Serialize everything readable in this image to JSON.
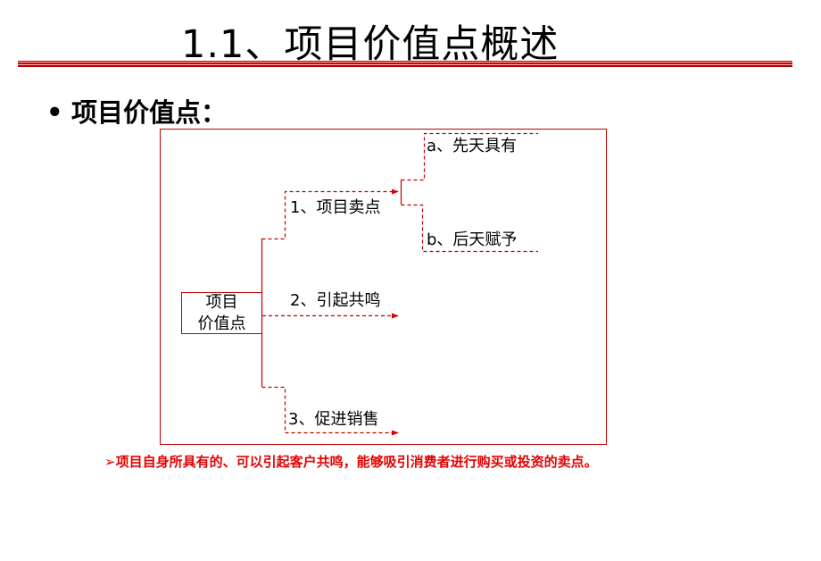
{
  "slide": {
    "title": "1.1、项目价值点概述",
    "bullet": {
      "marker": "•",
      "text": "项目价值点："
    }
  },
  "diagram": {
    "root": {
      "line1": "项目",
      "line2": "价值点"
    },
    "branches": [
      {
        "label": "1、项目卖点",
        "children": [
          {
            "label": "a、先天具有"
          },
          {
            "label": "b、后天赋予"
          }
        ]
      },
      {
        "label": "2、引起共鸣"
      },
      {
        "label": "3、促进销售"
      }
    ],
    "colors": {
      "frame": "#c00000",
      "connector": "#c00000",
      "arrowhead": "#e00000"
    }
  },
  "note": {
    "marker": "➢",
    "text": "项目自身所具有的、可以引起客户共鸣，能够吸引消费者进行购买或投资的卖点。",
    "color": "#e60000"
  }
}
